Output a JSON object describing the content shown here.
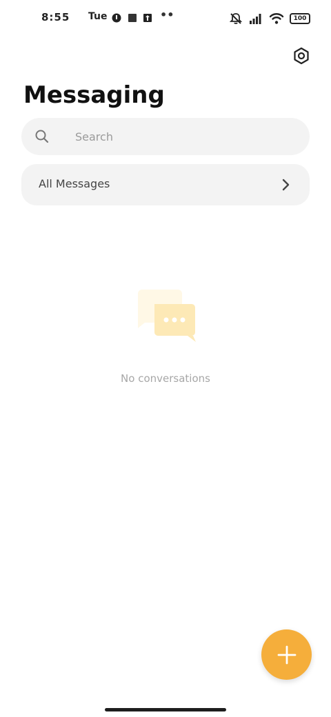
{
  "status_bar": {
    "time": "8:55",
    "date": "Tue",
    "battery": "100",
    "icons": [
      "notification-icon",
      "profile-icon",
      "square-icon",
      "upload-icon",
      "mute-icon",
      "signal-icon",
      "wifi-icon",
      "battery-icon"
    ]
  },
  "header": {
    "title": "Messaging",
    "settings_icon": "settings-icon"
  },
  "search": {
    "placeholder": "Search",
    "value": ""
  },
  "messages_row": {
    "label": "All Messages"
  },
  "empty_state": {
    "text": "No conversations"
  },
  "fab": {
    "icon": "plus-icon"
  },
  "colors": {
    "accent": "#f5ae3b",
    "surface": "#f3f3f3",
    "empty_illustration": "#fde9b6"
  }
}
